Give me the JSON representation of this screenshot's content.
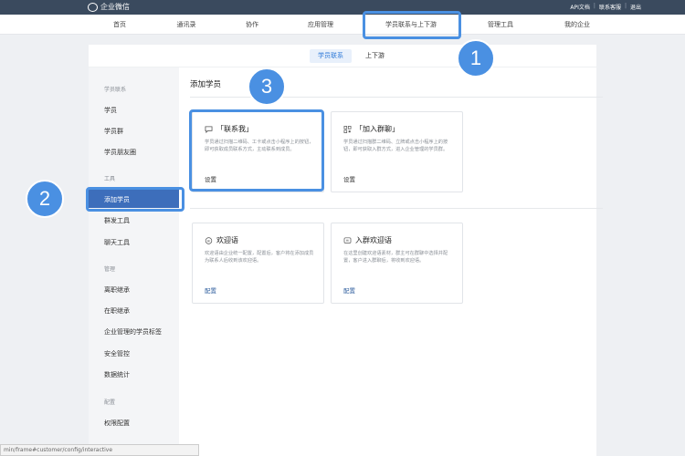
{
  "topbar": {
    "logo_text": "企业微信",
    "links": [
      "API文档",
      "联系客服",
      "退出"
    ]
  },
  "mainnav": {
    "items": [
      "首页",
      "通讯录",
      "协作",
      "应用管理",
      "学员联系与上下游",
      "管理工具",
      "我的企业"
    ]
  },
  "subtabs": [
    "学员联系",
    "上下游"
  ],
  "sidebar": {
    "group_contact": "学员联系",
    "contact_items": [
      "学员",
      "学员群",
      "学员朋友圈"
    ],
    "group_tools": "工具",
    "tool_items": [
      "添加学员",
      "群发工具",
      "聊天工具"
    ],
    "group_manage": "管理",
    "manage_items": [
      "离职继承",
      "在职继承",
      "企业管理的学员标签",
      "安全管控",
      "数据统计"
    ],
    "group_config": "配置",
    "config_items": [
      "权限配置"
    ]
  },
  "main": {
    "title": "添加学员",
    "cards": [
      {
        "icon": "chat-icon",
        "title": "「联系我」",
        "desc": "学员通过扫描二维码、工卡或点击小程序上的按钮，即可获取成员联系方式，主动联系到成员。",
        "action": "设置"
      },
      {
        "icon": "qrcode-icon",
        "title": "「加入群聊」",
        "desc": "学员通过扫描群二维码、立牌或点击小程序上的按钮，即可获取入群方式，进入企业管理的学员群。",
        "action": "设置"
      },
      {
        "icon": "greeting-icon",
        "title": "欢迎语",
        "desc": "欢迎语由企业统一配置，配置后，客户将在添加成员为联系人后收到该欢迎语。",
        "action": "配置"
      },
      {
        "icon": "group-greeting-icon",
        "title": "入群欢迎语",
        "desc": "在这里创建欢迎语素材，群主可在群聊中选择并配置，客户进入群聊后，将收到欢迎语。",
        "action": "配置"
      }
    ]
  },
  "annotations": [
    "1",
    "2",
    "3"
  ],
  "statusbar": {
    "url": "min/frame#customer/config/interactive"
  },
  "colors": {
    "accent": "#4a90e2",
    "sidebar_active": "#3d6ebb",
    "topbar": "#3a4a5e"
  }
}
